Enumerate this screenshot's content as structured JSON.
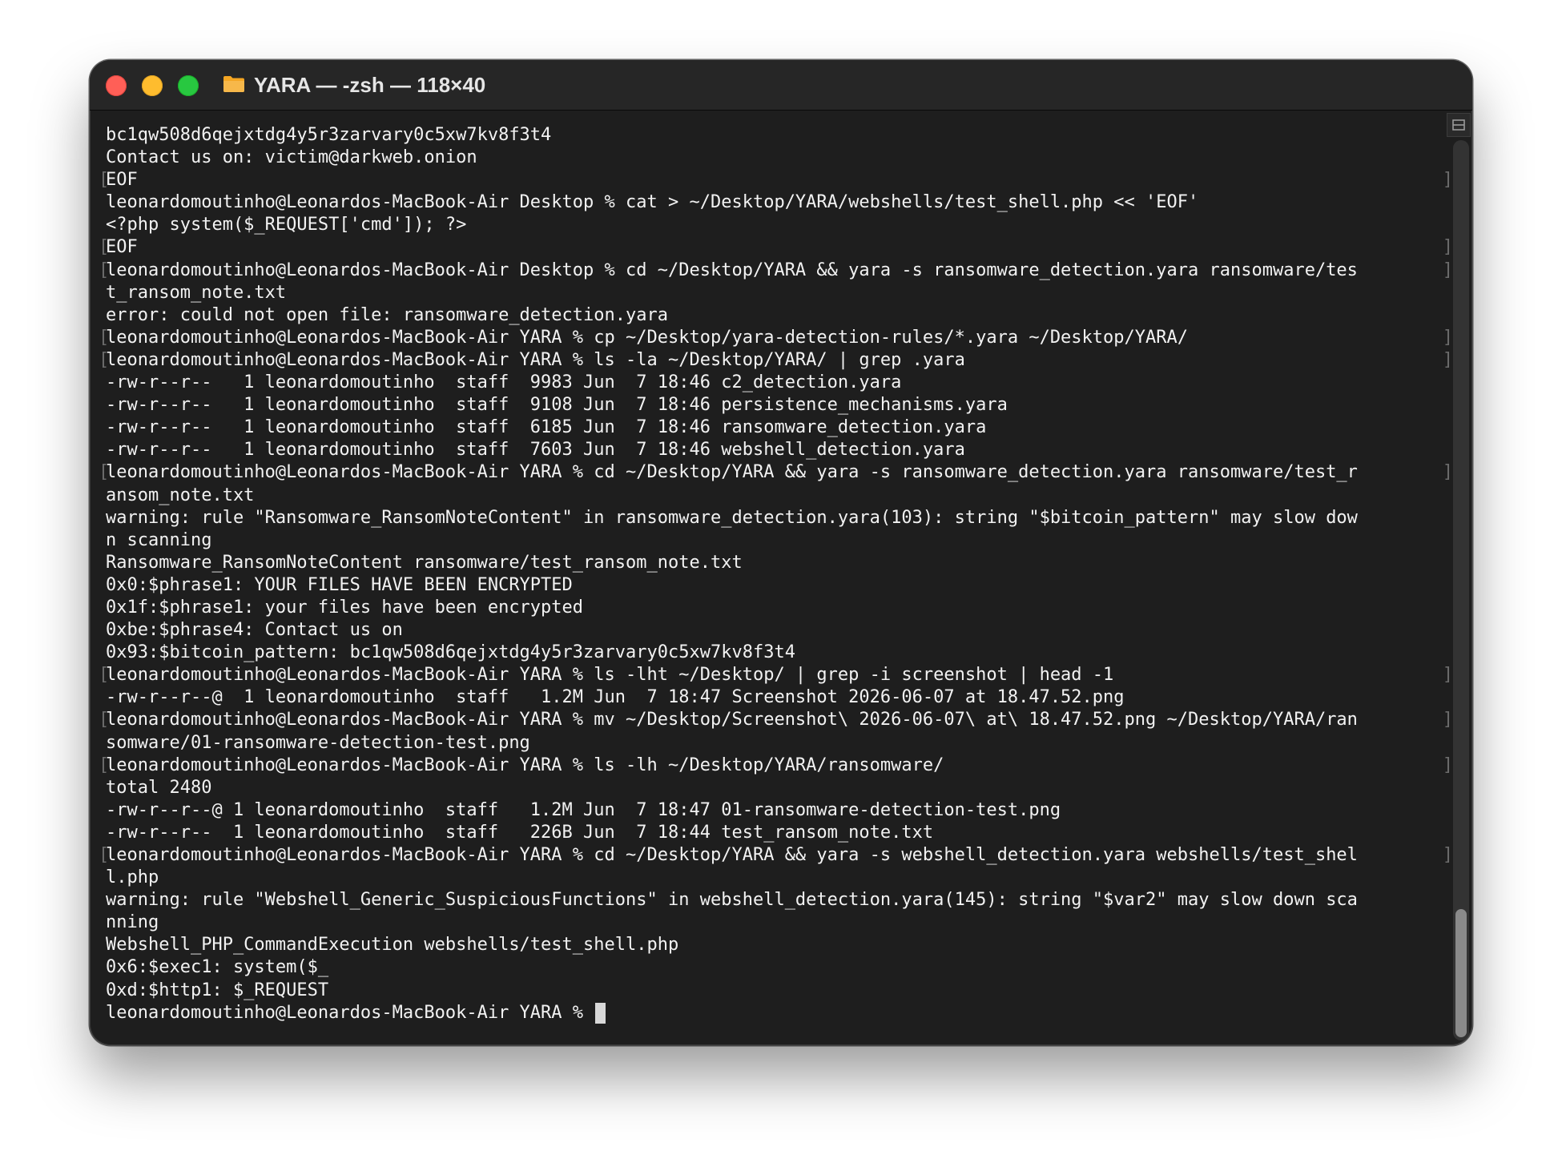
{
  "window": {
    "title": "YARA — -zsh — 118×40",
    "folder_icon": "folder-icon",
    "traffic_lights": [
      "close",
      "minimize",
      "maximize"
    ]
  },
  "terminal": {
    "lines": [
      {
        "text": "bc1qw508d6qejxtdg4y5r3zarvary0c5xw7kv8f3t4",
        "l": false,
        "r": false
      },
      {
        "text": "Contact us on: victim@darkweb.onion",
        "l": false,
        "r": false
      },
      {
        "text": "EOF",
        "l": true,
        "r": true
      },
      {
        "text": "leonardomoutinho@Leonardos-MacBook-Air Desktop % cat > ~/Desktop/YARA/webshells/test_shell.php << 'EOF'",
        "l": false,
        "r": false
      },
      {
        "text": "<?php system($_REQUEST['cmd']); ?>",
        "l": false,
        "r": false
      },
      {
        "text": "EOF",
        "l": true,
        "r": true
      },
      {
        "text": "leonardomoutinho@Leonardos-MacBook-Air Desktop % cd ~/Desktop/YARA && yara -s ransomware_detection.yara ransomware/tes",
        "l": true,
        "r": true
      },
      {
        "text": "t_ransom_note.txt",
        "l": false,
        "r": false
      },
      {
        "text": "error: could not open file: ransomware_detection.yara",
        "l": false,
        "r": false
      },
      {
        "text": "leonardomoutinho@Leonardos-MacBook-Air YARA % cp ~/Desktop/yara-detection-rules/*.yara ~/Desktop/YARA/",
        "l": true,
        "r": true
      },
      {
        "text": "leonardomoutinho@Leonardos-MacBook-Air YARA % ls -la ~/Desktop/YARA/ | grep .yara",
        "l": true,
        "r": true
      },
      {
        "text": "-rw-r--r--   1 leonardomoutinho  staff  9983 Jun  7 18:46 c2_detection.yara",
        "l": false,
        "r": false
      },
      {
        "text": "-rw-r--r--   1 leonardomoutinho  staff  9108 Jun  7 18:46 persistence_mechanisms.yara",
        "l": false,
        "r": false
      },
      {
        "text": "-rw-r--r--   1 leonardomoutinho  staff  6185 Jun  7 18:46 ransomware_detection.yara",
        "l": false,
        "r": false
      },
      {
        "text": "-rw-r--r--   1 leonardomoutinho  staff  7603 Jun  7 18:46 webshell_detection.yara",
        "l": false,
        "r": false
      },
      {
        "text": "leonardomoutinho@Leonardos-MacBook-Air YARA % cd ~/Desktop/YARA && yara -s ransomware_detection.yara ransomware/test_r",
        "l": true,
        "r": true
      },
      {
        "text": "ansom_note.txt",
        "l": false,
        "r": false
      },
      {
        "text": "warning: rule \"Ransomware_RansomNoteContent\" in ransomware_detection.yara(103): string \"$bitcoin_pattern\" may slow dow",
        "l": false,
        "r": false
      },
      {
        "text": "n scanning",
        "l": false,
        "r": false
      },
      {
        "text": "Ransomware_RansomNoteContent ransomware/test_ransom_note.txt",
        "l": false,
        "r": false
      },
      {
        "text": "0x0:$phrase1: YOUR FILES HAVE BEEN ENCRYPTED",
        "l": false,
        "r": false
      },
      {
        "text": "0x1f:$phrase1: your files have been encrypted",
        "l": false,
        "r": false
      },
      {
        "text": "0xbe:$phrase4: Contact us on",
        "l": false,
        "r": false
      },
      {
        "text": "0x93:$bitcoin_pattern: bc1qw508d6qejxtdg4y5r3zarvary0c5xw7kv8f3t4",
        "l": false,
        "r": false
      },
      {
        "text": "leonardomoutinho@Leonardos-MacBook-Air YARA % ls -lht ~/Desktop/ | grep -i screenshot | head -1",
        "l": true,
        "r": true
      },
      {
        "text": "-rw-r--r--@  1 leonardomoutinho  staff   1.2M Jun  7 18:47 Screenshot 2026-06-07 at 18.47.52.png",
        "l": false,
        "r": false
      },
      {
        "text": "leonardomoutinho@Leonardos-MacBook-Air YARA % mv ~/Desktop/Screenshot\\ 2026-06-07\\ at\\ 18.47.52.png ~/Desktop/YARA/ran",
        "l": true,
        "r": true
      },
      {
        "text": "somware/01-ransomware-detection-test.png",
        "l": false,
        "r": false
      },
      {
        "text": "leonardomoutinho@Leonardos-MacBook-Air YARA % ls -lh ~/Desktop/YARA/ransomware/",
        "l": true,
        "r": true
      },
      {
        "text": "total 2480",
        "l": false,
        "r": false
      },
      {
        "text": "-rw-r--r--@ 1 leonardomoutinho  staff   1.2M Jun  7 18:47 01-ransomware-detection-test.png",
        "l": false,
        "r": false
      },
      {
        "text": "-rw-r--r--  1 leonardomoutinho  staff   226B Jun  7 18:44 test_ransom_note.txt",
        "l": false,
        "r": false
      },
      {
        "text": "leonardomoutinho@Leonardos-MacBook-Air YARA % cd ~/Desktop/YARA && yara -s webshell_detection.yara webshells/test_shel",
        "l": true,
        "r": true
      },
      {
        "text": "l.php",
        "l": false,
        "r": false
      },
      {
        "text": "warning: rule \"Webshell_Generic_SuspiciousFunctions\" in webshell_detection.yara(145): string \"$var2\" may slow down sca",
        "l": false,
        "r": false
      },
      {
        "text": "nning",
        "l": false,
        "r": false
      },
      {
        "text": "Webshell_PHP_CommandExecution webshells/test_shell.php",
        "l": false,
        "r": false
      },
      {
        "text": "0x6:$exec1: system($_",
        "l": false,
        "r": false
      },
      {
        "text": "0xd:$http1: $_REQUEST",
        "l": false,
        "r": false
      }
    ],
    "prompt": "leonardomoutinho@Leonardos-MacBook-Air YARA % ",
    "mark_left": "[",
    "mark_right": "]"
  },
  "colors": {
    "background": "#1e1e1e",
    "foreground": "#f2f2f2",
    "titlebar": "#262626",
    "close": "#ff5f57",
    "minimize": "#febc2e",
    "maximize": "#28c840"
  }
}
